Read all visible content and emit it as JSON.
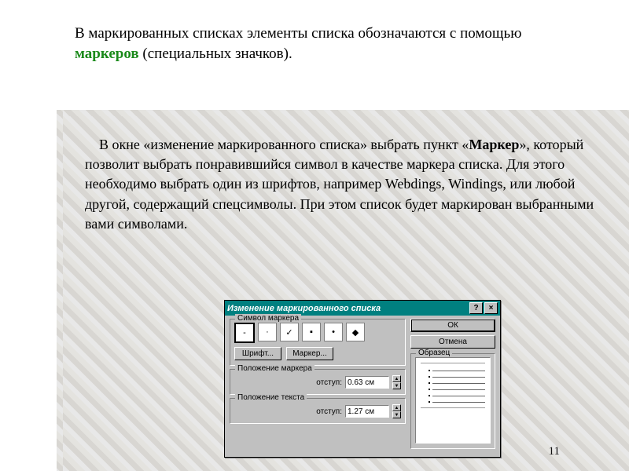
{
  "intro": {
    "t1": "В маркированных списках элементы списка обозначаются с помощью ",
    "emph": "маркеров",
    "t2": " (специальных значков)."
  },
  "body": {
    "t1": "В окне «изменение маркированного списка» выбрать пункт «",
    "bold": "Маркер",
    "t2": "», который позволит выбрать понравившийся символ в качестве маркера списка. Для этого необходимо выбрать один из шрифтов, например Webdings, Windings, или любой другой, содержащий спецсимволы. При этом список будет маркирован выбранными вами символами."
  },
  "dialog": {
    "title": "Изменение маркированного списка",
    "help": "?",
    "close": "×",
    "grp_symbol": "Символ маркера",
    "markers": [
      "-",
      "·",
      "✓",
      "▪",
      "•",
      "◆"
    ],
    "font_btn": "Шрифт...",
    "marker_btn": "Маркер...",
    "grp_pos_marker": "Положение маркера",
    "grp_pos_text": "Положение текста",
    "indent_label": "отступ:",
    "indent1": "0.63 см",
    "indent2": "1.27 см",
    "ok": "ОК",
    "cancel": "Отмена",
    "grp_preview": "Образец"
  },
  "pagenum": "11"
}
